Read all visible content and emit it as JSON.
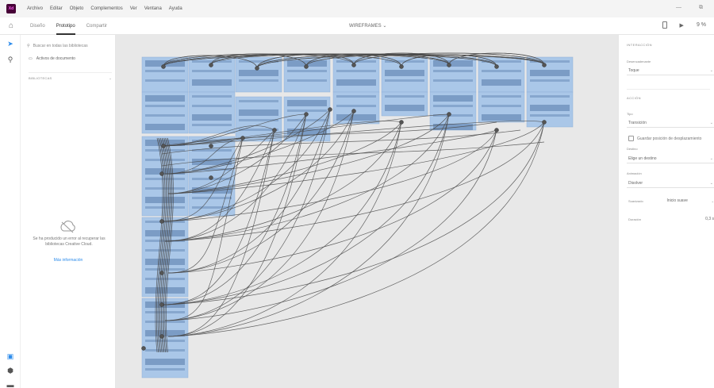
{
  "app": {
    "logo_text": "Xd"
  },
  "menubar": {
    "items": [
      "Archivo",
      "Editar",
      "Objeto",
      "Complementos",
      "Ver",
      "Ventana",
      "Ayuda"
    ]
  },
  "tabs": [
    {
      "label": "Diseño",
      "active": false
    },
    {
      "label": "Prototipo",
      "active": true
    },
    {
      "label": "Compartir",
      "active": false
    }
  ],
  "document": {
    "title": "WIREFRAMES ⌄"
  },
  "toolbar_right": {
    "zoom": "9 %"
  },
  "library": {
    "search_placeholder": "Buscar en todas las bibliotecas",
    "doc_assets_label": "Activos de documento",
    "section_title": "BIBLIOTECAS",
    "error_message": "Se ha producido un error al recuperar las bibliotecas Creative Cloud.",
    "more_info_link": "Más información"
  },
  "properties": {
    "interaction_title": "INTERACCIÓN",
    "trigger_label": "Desencadenante",
    "trigger_value": "Toque",
    "action_title": "ACCIÓN",
    "type_label": "Tipo",
    "type_value": "Transición",
    "preserve_scroll_label": "Guardar posición de desplazamiento",
    "destination_label": "Destino",
    "destination_value": "Elige un destino",
    "animation_label": "Animación",
    "animation_value": "Disolver",
    "easing_label": "Suavizado",
    "easing_value": "Inicio suave",
    "duration_label": "Duración",
    "duration_value": "0,3 s"
  },
  "colors": {
    "accent_blue": "#2d8ceb",
    "artboard_fill": "#aac7e8",
    "artboard_dark": "#6f91bb",
    "wire": "#4a4a4a",
    "canvas_bg": "#e8e8e8"
  },
  "icons": [
    "home-icon",
    "select-tool-icon",
    "zoom-tool-icon",
    "search-icon",
    "document-assets-icon",
    "creative-cloud-icon",
    "device-preview-icon",
    "play-icon",
    "libraries-icon",
    "plugins-icon",
    "settings-icon",
    "chevron-down-icon"
  ]
}
